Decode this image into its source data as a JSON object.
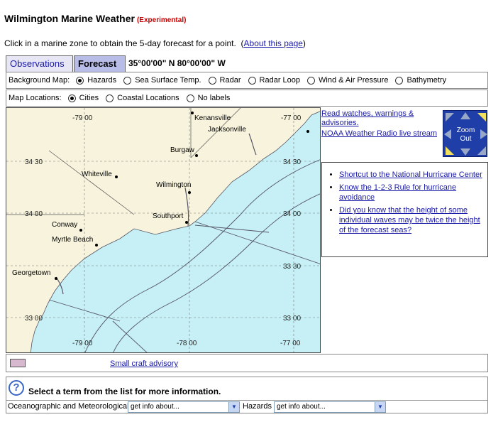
{
  "header": {
    "title": "Wilmington Marine Weather",
    "tag": "(Experimental)",
    "intro_text": "Click in a marine zone to obtain the 5-day forecast for a point.",
    "intro_paren_open": "(",
    "about_link": "About this page",
    "intro_paren_close": ")"
  },
  "tabs": [
    {
      "label": "Observations",
      "selected": false
    },
    {
      "label": "Forecast",
      "selected": true
    }
  ],
  "coordinates": "35°00'00\" N  80°00'00\" W",
  "background_map": {
    "label": "Background Map:",
    "options": [
      "Hazards",
      "Sea Surface Temp.",
      "Radar",
      "Radar Loop",
      "Wind & Air Pressure",
      "Bathymetry"
    ],
    "selected": "Hazards"
  },
  "map_locations": {
    "label": "Map Locations:",
    "options": [
      "Cities",
      "Coastal Locations",
      "No labels"
    ],
    "selected": "Cities"
  },
  "map": {
    "land_color": "#f7f3dc",
    "water_color": "#c6f0f5",
    "cities": [
      "Kenansville",
      "Jacksonville",
      "Burgaw",
      "Whiteville",
      "Wilmington",
      "Southport",
      "Conway",
      "Myrtle Beach",
      "Georgetown"
    ],
    "lon_labels_top": [
      "-79 00",
      "-77 00"
    ],
    "lon_labels_bottom": [
      "-79 00",
      "-78 00",
      "-77 00"
    ],
    "lat_labels_left": [
      "34 30",
      "34 00",
      "33 00"
    ],
    "lat_labels_right": [
      "34 30",
      "34 00",
      "33 30",
      "33 00"
    ]
  },
  "right_panel": {
    "watches_link": "Read watches, warnings & advisories.",
    "radio_link": "NOAA Weather Radio live stream",
    "zoom_label_line1": "Zoom",
    "zoom_label_line2": "Out",
    "hurricane_links": [
      "Shortcut to the National Hurricane Center",
      "Know the 1-2-3 Rule for hurricane avoidance",
      "Did you know that the height of some individual waves may be twice the height of the forecast seas?"
    ]
  },
  "legend": {
    "swatch_color": "#d6b8cf",
    "label": "Small craft advisory"
  },
  "terms": {
    "prompt": "Select a term from the list for more information.",
    "ocean_label": "Oceanographic and Meteorological",
    "ocean_select": "get info about...",
    "hazards_label": "Hazards",
    "hazards_select": "get info about..."
  }
}
